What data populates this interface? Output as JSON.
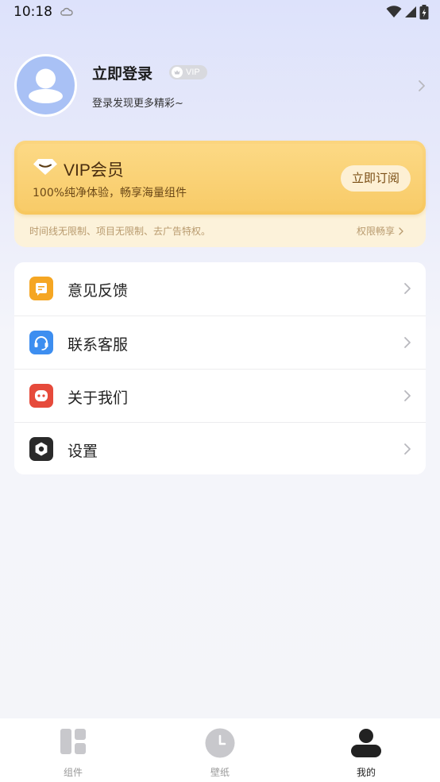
{
  "status_bar": {
    "time": "10:18"
  },
  "profile": {
    "title": "立即登录",
    "vip_tag": "VIP",
    "subtitle": "登录发现更多精彩~"
  },
  "vip_card": {
    "title": "VIP会员",
    "description": "100%纯净体验，畅享海量组件",
    "button": "立即订阅",
    "footer_text": "时间线无限制、项目无限制、去广告特权。",
    "footer_link": "权限畅享"
  },
  "menu": {
    "items": [
      {
        "label": "意见反馈",
        "icon": "feedback-icon",
        "color": "#f5a623"
      },
      {
        "label": "联系客服",
        "icon": "headset-icon",
        "color": "#3d8ef0"
      },
      {
        "label": "关于我们",
        "icon": "about-icon",
        "color": "#e64a3b"
      },
      {
        "label": "设置",
        "icon": "settings-icon",
        "color": "#2a2a2a"
      }
    ]
  },
  "bottom_nav": {
    "items": [
      {
        "label": "组件",
        "icon": "widgets-icon",
        "active": false
      },
      {
        "label": "壁纸",
        "icon": "clock-icon",
        "active": false
      },
      {
        "label": "我的",
        "icon": "profile-icon",
        "active": true
      }
    ]
  },
  "colors": {
    "accent_gold": "#f7c75e",
    "active_nav": "#222222",
    "inactive_nav": "#c8c8cc"
  }
}
